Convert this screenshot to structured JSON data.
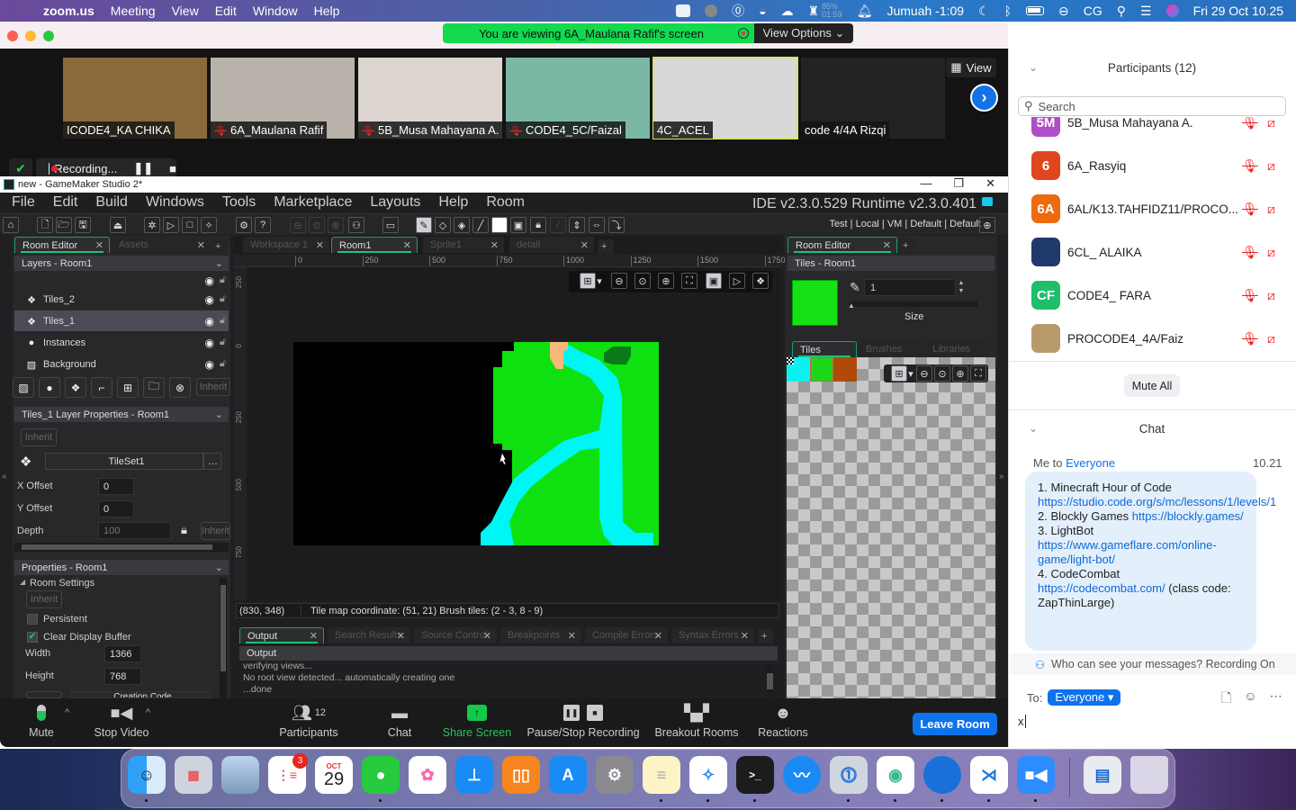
{
  "menubar": {
    "apple": "",
    "app": "zoom.us",
    "items": [
      "Meeting",
      "View",
      "Edit",
      "Window",
      "Help"
    ],
    "battery_pct": "85%",
    "battery_time": "01:59",
    "prayer": "Jumuah -1:09",
    "user": "CG",
    "datetime": "Fri 29 Oct  10.25"
  },
  "zoom": {
    "viewing_banner": "You are viewing 6A_Maulana Rafif's screen",
    "view_options": "View Options ⌄",
    "view_button": "View",
    "recording": "Recording...",
    "tiles": [
      {
        "name": "ICODE4_KA CHIKA",
        "muted": false,
        "color": "#8a6a3a"
      },
      {
        "name": "6A_Maulana Rafif",
        "muted": true,
        "color": "#b8b2aa"
      },
      {
        "name": "5B_Musa Mahayana A.",
        "muted": true,
        "color": "#ddd6d0"
      },
      {
        "name": "CODE4_5C/Faizal",
        "muted": true,
        "color": "#7ab8a4"
      },
      {
        "name": "4C_ACEL",
        "muted": false,
        "color": "#d8d8d8",
        "active": true
      },
      {
        "name": "code 4/4A Rizqi",
        "muted": false,
        "color": "#232323"
      }
    ],
    "toolbar": {
      "mute": "Mute",
      "stop_video": "Stop Video",
      "participants": "Participants",
      "participants_count": "12",
      "chat": "Chat",
      "share_screen": "Share Screen",
      "pause_stop": "Pause/Stop Recording",
      "breakout": "Breakout Rooms",
      "reactions": "Reactions",
      "leave": "Leave Room"
    },
    "participants_panel": {
      "title": "Participants (12)",
      "search_placeholder": "Search",
      "rows": [
        {
          "initials": "5M",
          "name": "5B_Musa Mahayana A.",
          "color": "#b04ec8"
        },
        {
          "initials": "6",
          "name": "6A_Rasyiq",
          "color": "#e0461e"
        },
        {
          "initials": "6A",
          "name": "6AL/K13.TAHFIDZ11/PROCO...",
          "color": "#ee6a10"
        },
        {
          "initials": "",
          "name": "6CL_ ALAIKA",
          "color": "#1f3a6a"
        },
        {
          "initials": "CF",
          "name": "CODE4_ FARA",
          "color": "#1fbe6a"
        },
        {
          "initials": "",
          "name": "PROCODE4_4A/Faiz",
          "color": "#b89a6a"
        }
      ],
      "mute_all": "Mute All"
    },
    "chat_panel": {
      "title": "Chat",
      "from": "Me to ",
      "to": "Everyone",
      "time": "10.21",
      "messages": [
        {
          "text": "1. Minecraft Hour of Code ",
          "link": "https://studio.code.org/s/mc/lessons/1/levels/1"
        },
        {
          "text": "2. Blockly Games ",
          "link": "https://blockly.games/"
        },
        {
          "text": "3. LightBot ",
          "link": "https://www.gameflare.com/online-game/light-bot/"
        },
        {
          "text": "4. CodeCombat ",
          "link": "https://codecombat.com/",
          "suffix": " (class code: ZapThinLarge)"
        }
      ],
      "who_can_see": "Who can see your messages? Recording On",
      "to_label": "To:",
      "to_value": "Everyone ▾",
      "input_value": "x"
    }
  },
  "gm": {
    "window_title": "new - GameMaker Studio 2*",
    "menu": [
      "File",
      "Edit",
      "Build",
      "Windows",
      "Tools",
      "Marketplace",
      "Layouts",
      "Help",
      "Room"
    ],
    "version": "IDE v2.3.0.529  Runtime v2.3.0.401",
    "targets": "Test  |  Local  |  VM  |  Default  |  Default",
    "left_tabs": [
      {
        "label": "Room Editor",
        "active": true
      },
      {
        "label": "Assets",
        "active": false
      }
    ],
    "layers_header": "Layers - Room1",
    "layers": [
      {
        "name": "Tiles_2",
        "icon": "❖"
      },
      {
        "name": "Tiles_1",
        "icon": "❖",
        "selected": true
      },
      {
        "name": "Instances",
        "icon": "●"
      },
      {
        "name": "Background",
        "icon": "▨"
      }
    ],
    "inherit": "Inherit",
    "layer_props_header": "Tiles_1 Layer Properties - Room1",
    "tileset": "TileSet1",
    "x_offset_label": "X Offset",
    "x_offset": "0",
    "y_offset_label": "Y Offset",
    "y_offset": "0",
    "depth_label": "Depth",
    "depth": "100",
    "room_props_header": "Properties - Room1",
    "room_settings": "Room Settings",
    "persistent": "Persistent",
    "clear_display": "Clear Display Buffer",
    "width_label": "Width",
    "width": "1366",
    "height_label": "Height",
    "height": "768",
    "creation_code": "Creation Code",
    "doc_tabs": [
      {
        "label": "Workspace 1",
        "active": false
      },
      {
        "label": "Room1",
        "active": true
      },
      {
        "label": "Sprite1",
        "active": false
      },
      {
        "label": "detail",
        "active": false
      }
    ],
    "ruler": [
      "0",
      "250",
      "500",
      "750",
      "1000",
      "1250",
      "1500",
      "1750"
    ],
    "vruler": [
      "250",
      "0",
      "250",
      "500",
      "750"
    ],
    "status_coords": "(830, 348)",
    "status_info": "Tile map coordinate: (51, 21) Brush tiles: (2 - 3, 8 - 9)",
    "output_tabs": [
      "Output",
      "Search Results",
      "Source Control",
      "Breakpoints",
      "Compile Errors",
      "Syntax Errors"
    ],
    "output_header": "Output",
    "output_lines": [
      "verifying views...",
      "No root view detected... automatically creating one",
      "...done"
    ],
    "right_tab": "Room Editor",
    "tiles_header": "Tiles - Room1",
    "brush_size": "1",
    "size_label": "Size",
    "tile_tabs": [
      "Tiles",
      "Brushes",
      "Libraries"
    ]
  },
  "dock": {
    "reminders_badge": "3",
    "calendar_month": "OCT",
    "calendar_day": "29"
  }
}
